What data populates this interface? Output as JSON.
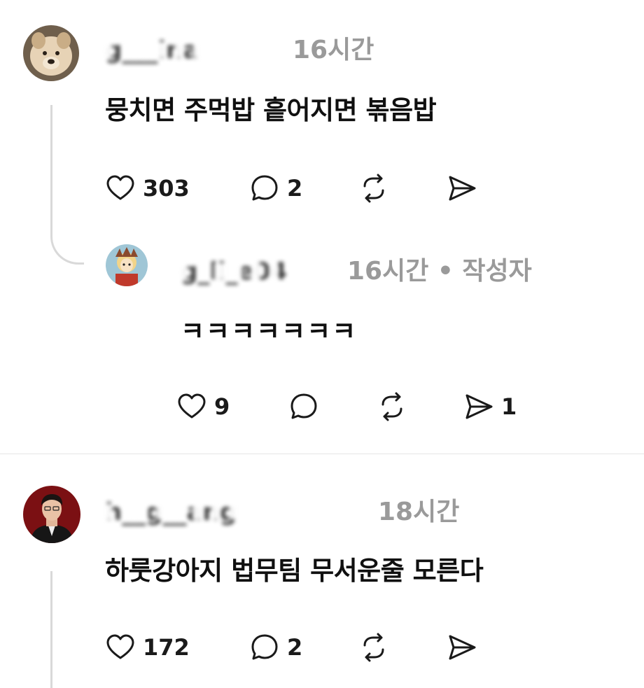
{
  "comments": [
    {
      "username": "g___ina",
      "time": "16시간",
      "text": "뭉치면 주먹밥 흩어지면 볶음밥",
      "likes": "303",
      "replies": "2"
    },
    {
      "username": "g_ll_e04",
      "time": "16시간",
      "author_badge": "• 작성자",
      "text": "ㅋㅋㅋㅋㅋㅋㅋ",
      "likes": "9",
      "replies": "",
      "shares": "1"
    },
    {
      "username": "h__g__ang",
      "time": "18시간",
      "text": "하룻강아지 법무팀 무서운줄 모른다",
      "likes": "172",
      "replies": "2"
    }
  ],
  "icons": {
    "like": "heart-icon",
    "reply": "comment-icon",
    "repost": "repost-icon",
    "share": "send-icon"
  }
}
